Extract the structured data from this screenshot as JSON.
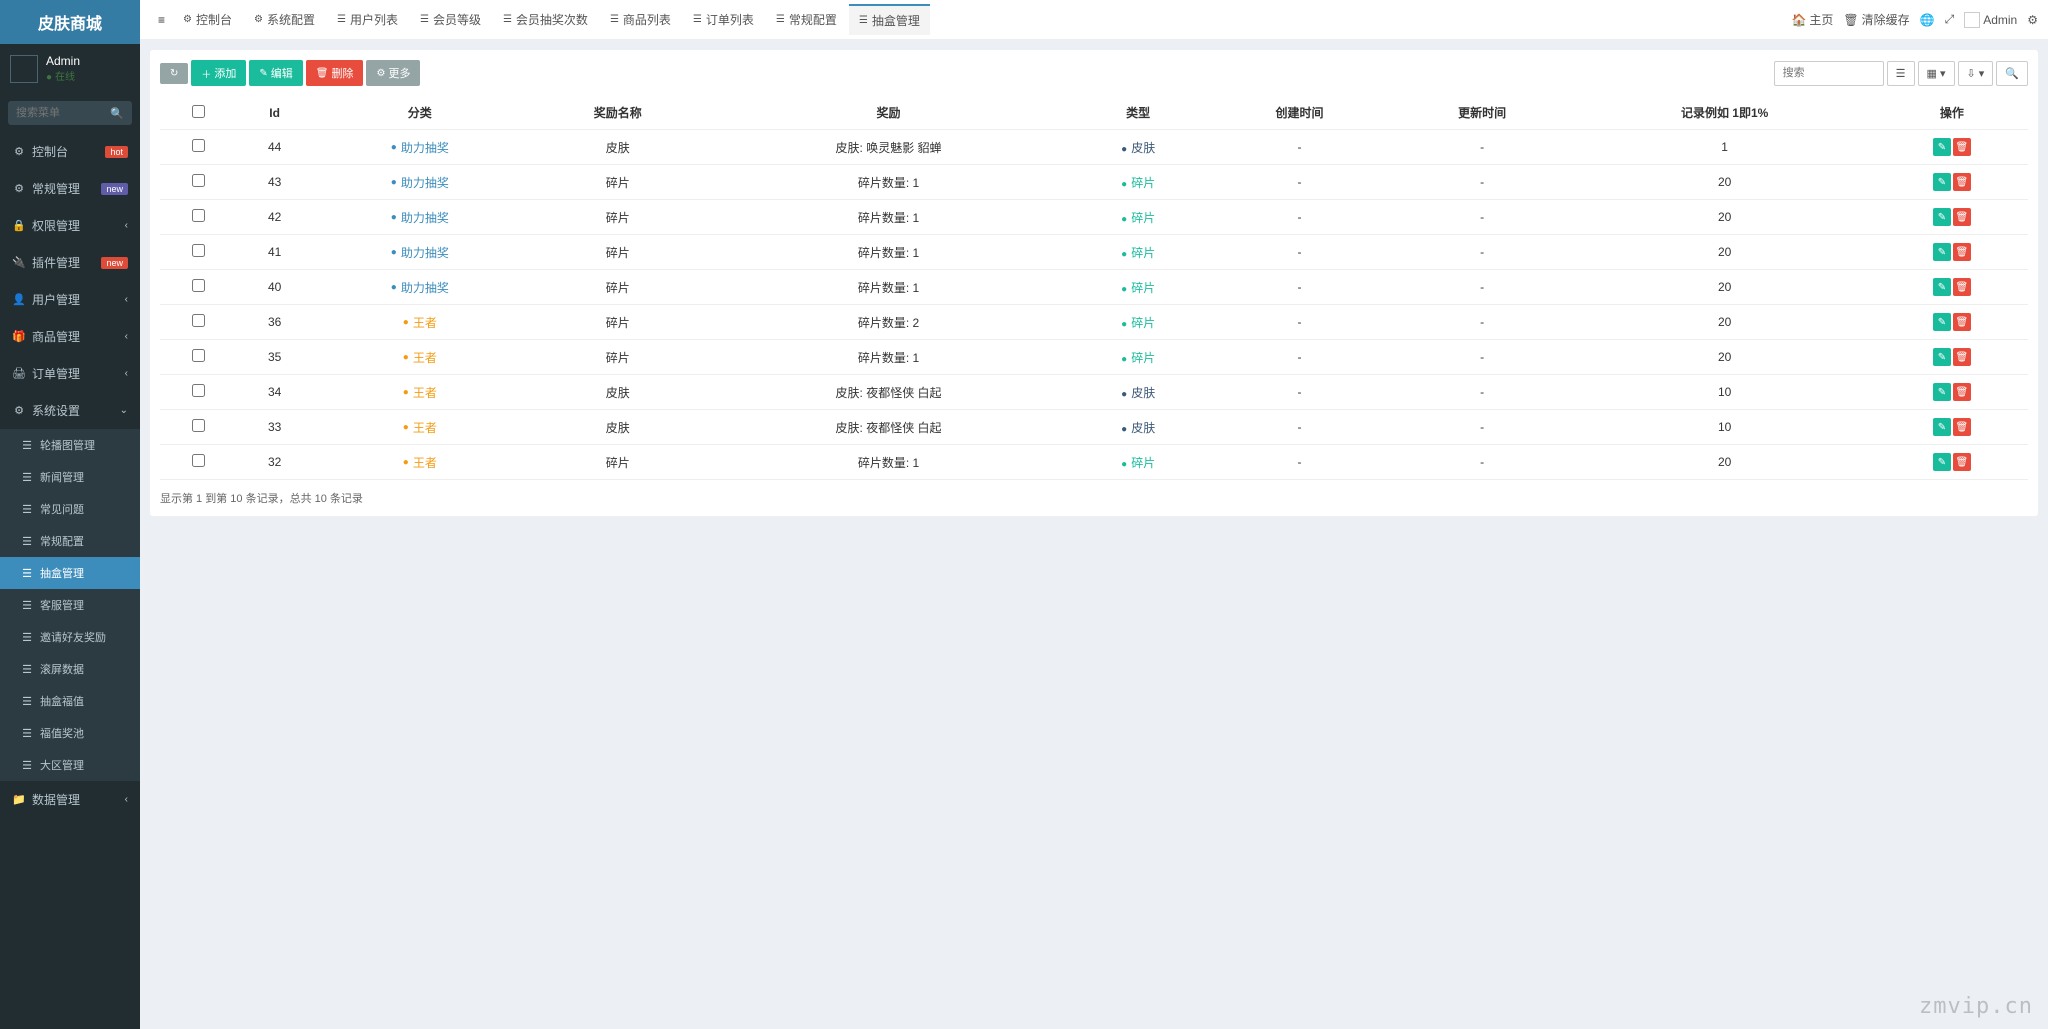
{
  "brand": "皮肤商城",
  "user": {
    "name": "Admin",
    "status": "在线"
  },
  "search_placeholder": "搜索菜单",
  "sidebar": {
    "items": [
      {
        "icon": "⚙",
        "label": "控制台",
        "badge": "hot",
        "badge_class": "badge-hot"
      },
      {
        "icon": "⚙",
        "label": "常规管理",
        "badge": "new",
        "badge_class": "badge-new"
      },
      {
        "icon": "🔒",
        "label": "权限管理",
        "chevron": true
      },
      {
        "icon": "🔌",
        "label": "插件管理",
        "badge": "new",
        "badge_class": "badge-newred"
      },
      {
        "icon": "👤",
        "label": "用户管理",
        "chevron": true
      },
      {
        "icon": "🎁",
        "label": "商品管理",
        "chevron": true
      },
      {
        "icon": "🖨",
        "label": "订单管理",
        "chevron": true
      },
      {
        "icon": "⚙",
        "label": "系统设置",
        "chevron": true,
        "expanded": true
      }
    ],
    "submenu": [
      {
        "label": "轮播图管理"
      },
      {
        "label": "新闻管理"
      },
      {
        "label": "常见问题"
      },
      {
        "label": "常规配置"
      },
      {
        "label": "抽盒管理",
        "active": true
      },
      {
        "label": "客服管理"
      },
      {
        "label": "邀请好友奖励"
      },
      {
        "label": "滚屏数据"
      },
      {
        "label": "抽盒福值"
      },
      {
        "label": "福值奖池"
      },
      {
        "label": "大区管理"
      }
    ],
    "extra": {
      "icon": "📁",
      "label": "数据管理",
      "chevron": true
    }
  },
  "tabs": [
    {
      "icon": "⚙",
      "label": "控制台"
    },
    {
      "icon": "⚙",
      "label": "系统配置"
    },
    {
      "icon": "☰",
      "label": "用户列表"
    },
    {
      "icon": "☰",
      "label": "会员等级"
    },
    {
      "icon": "☰",
      "label": "会员抽奖次数"
    },
    {
      "icon": "☰",
      "label": "商品列表"
    },
    {
      "icon": "☰",
      "label": "订单列表"
    },
    {
      "icon": "☰",
      "label": "常规配置"
    },
    {
      "icon": "☰",
      "label": "抽盒管理",
      "active": true
    }
  ],
  "nav_right": {
    "home": "主页",
    "clear": "清除缓存",
    "user": "Admin"
  },
  "toolbar": {
    "refresh": "↻",
    "add": "添加",
    "edit": "编辑",
    "delete": "删除",
    "more": "更多",
    "search_ph": "搜索"
  },
  "columns": [
    "Id",
    "分类",
    "奖励名称",
    "奖励",
    "类型",
    "创建时间",
    "更新时间",
    "记录例如 1即1%",
    "操作"
  ],
  "rows": [
    {
      "id": 44,
      "cat": "助力抽奖",
      "cat_cls": "cat-blue",
      "name": "皮肤",
      "reward": "皮肤: 唤灵魅影 貂蝉",
      "type": "皮肤",
      "type_cls": "type-skin",
      "ct": "-",
      "ut": "-",
      "rate": 1
    },
    {
      "id": 43,
      "cat": "助力抽奖",
      "cat_cls": "cat-blue",
      "name": "碎片",
      "reward": "碎片数量: 1",
      "type": "碎片",
      "type_cls": "type-frag",
      "ct": "-",
      "ut": "-",
      "rate": 20
    },
    {
      "id": 42,
      "cat": "助力抽奖",
      "cat_cls": "cat-blue",
      "name": "碎片",
      "reward": "碎片数量: 1",
      "type": "碎片",
      "type_cls": "type-frag",
      "ct": "-",
      "ut": "-",
      "rate": 20
    },
    {
      "id": 41,
      "cat": "助力抽奖",
      "cat_cls": "cat-blue",
      "name": "碎片",
      "reward": "碎片数量: 1",
      "type": "碎片",
      "type_cls": "type-frag",
      "ct": "-",
      "ut": "-",
      "rate": 20
    },
    {
      "id": 40,
      "cat": "助力抽奖",
      "cat_cls": "cat-blue",
      "name": "碎片",
      "reward": "碎片数量: 1",
      "type": "碎片",
      "type_cls": "type-frag",
      "ct": "-",
      "ut": "-",
      "rate": 20
    },
    {
      "id": 36,
      "cat": "王者",
      "cat_cls": "cat-orange",
      "name": "碎片",
      "reward": "碎片数量: 2",
      "type": "碎片",
      "type_cls": "type-frag",
      "ct": "-",
      "ut": "-",
      "rate": 20
    },
    {
      "id": 35,
      "cat": "王者",
      "cat_cls": "cat-orange",
      "name": "碎片",
      "reward": "碎片数量: 1",
      "type": "碎片",
      "type_cls": "type-frag",
      "ct": "-",
      "ut": "-",
      "rate": 20
    },
    {
      "id": 34,
      "cat": "王者",
      "cat_cls": "cat-orange",
      "name": "皮肤",
      "reward": "皮肤: 夜都怪侠 白起",
      "type": "皮肤",
      "type_cls": "type-skin",
      "ct": "-",
      "ut": "-",
      "rate": 10
    },
    {
      "id": 33,
      "cat": "王者",
      "cat_cls": "cat-orange",
      "name": "皮肤",
      "reward": "皮肤: 夜都怪侠 白起",
      "type": "皮肤",
      "type_cls": "type-skin",
      "ct": "-",
      "ut": "-",
      "rate": 10
    },
    {
      "id": 32,
      "cat": "王者",
      "cat_cls": "cat-orange",
      "name": "碎片",
      "reward": "碎片数量: 1",
      "type": "碎片",
      "type_cls": "type-frag",
      "ct": "-",
      "ut": "-",
      "rate": 20
    }
  ],
  "footer": "显示第 1 到第 10 条记录，总共 10 条记录",
  "watermark": "zmvip.cn"
}
